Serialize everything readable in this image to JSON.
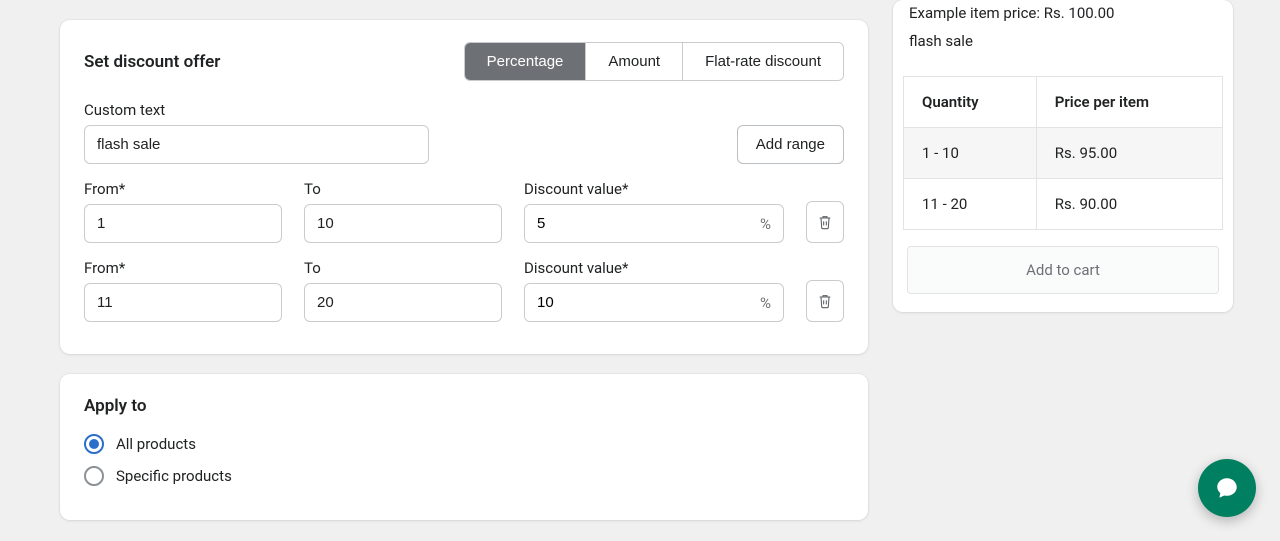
{
  "discount": {
    "title": "Set discount offer",
    "tabs": {
      "percentage": "Percentage",
      "amount": "Amount",
      "flat": "Flat-rate discount"
    },
    "custom_text_label": "Custom text",
    "custom_text_value": "flash sale",
    "add_range_label": "Add range",
    "labels": {
      "from": "From*",
      "to": "To",
      "discount_value": "Discount value*",
      "unit": "%"
    },
    "ranges": [
      {
        "from": "1",
        "to": "10",
        "value": "5"
      },
      {
        "from": "11",
        "to": "20",
        "value": "10"
      }
    ]
  },
  "apply": {
    "title": "Apply to",
    "options": {
      "all": "All products",
      "specific": "Specific products"
    }
  },
  "preview": {
    "example_line": "Example item price: Rs. 100.00",
    "custom_text": "flash sale",
    "headers": {
      "qty": "Quantity",
      "price": "Price per item"
    },
    "rows": [
      {
        "qty": "1 - 10",
        "price": "Rs. 95.00"
      },
      {
        "qty": "11 - 20",
        "price": "Rs. 90.00"
      }
    ],
    "cart_label": "Add to cart"
  }
}
